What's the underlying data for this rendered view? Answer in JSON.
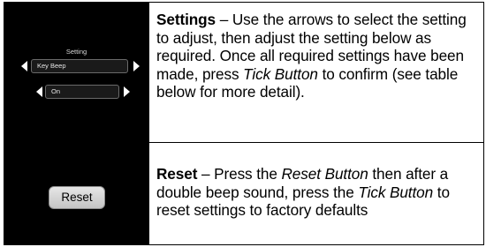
{
  "settings_row": {
    "display": {
      "caption": "Setting",
      "setting_value": "Key Beep",
      "option_value": "On"
    },
    "description": {
      "heading": "Settings",
      "p1": " – Use the arrows to select the setting to adjust, then adjust the setting below as required. Once all required settings have been made, press ",
      "tick_button": "Tick Button",
      "p2": " to confirm (see table below for more detail)."
    }
  },
  "reset_row": {
    "button_label": "Reset",
    "description": {
      "heading": "Reset",
      "p1": " – Press the ",
      "reset_button": "Reset Button",
      "p2": " then after a double beep sound, press the ",
      "tick_button": "Tick Button",
      "p3": " to reset settings to factory defaults"
    }
  },
  "colors": {
    "screen_background": "#000000",
    "border": "#000000",
    "text": "#000000"
  }
}
